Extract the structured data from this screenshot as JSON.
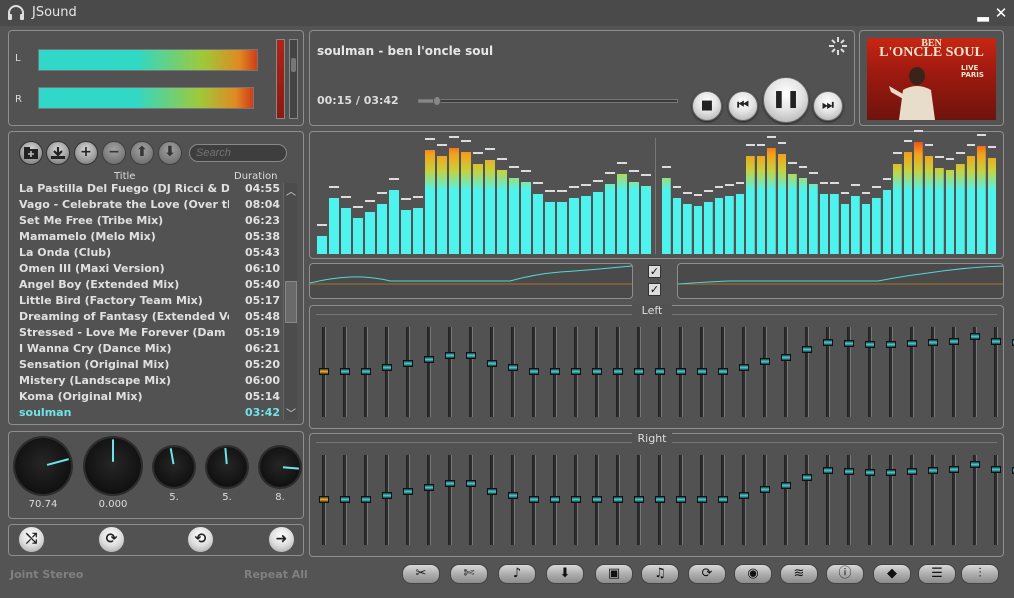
{
  "window": {
    "title": "JSound",
    "minimize_glyph": "▂",
    "close_glyph": "✕"
  },
  "vu": {
    "left_label": "L",
    "right_label": "R"
  },
  "now_playing": {
    "title": "soulman - ben l'oncle soul",
    "time": "00:15 / 03:42",
    "progress_fraction": 0.07
  },
  "controls": {
    "stop": "■",
    "prev": "⏮",
    "pause": "❚❚",
    "next": "⏭"
  },
  "album": {
    "line1": "BEN",
    "line2": "L'ONCLE SOUL",
    "line3": "LIVE",
    "line4": "PARIS"
  },
  "playlist_toolbar": {
    "search_placeholder": "Search"
  },
  "playlist": {
    "col_title": "Title",
    "col_duration": "Duration",
    "rows": [
      {
        "title": "La Pastilla Del Fuego (DJ Ricci & DF...",
        "duration": "04:55"
      },
      {
        "title": "Vago - Celebrate the Love (Over th...",
        "duration": "08:04"
      },
      {
        "title": "Set Me Free (Tribe Mix)",
        "duration": "06:23"
      },
      {
        "title": "Mamamelo (Melo Mix)",
        "duration": "05:38"
      },
      {
        "title": "La Onda (Club)",
        "duration": "05:43"
      },
      {
        "title": "Omen III (Maxi Version)",
        "duration": "06:10"
      },
      {
        "title": "Angel Boy (Extended Mix)",
        "duration": "05:40"
      },
      {
        "title": "Little Bird (Factory Team Mix)",
        "duration": "05:17"
      },
      {
        "title": "Dreaming of Fantasy (Extended Voc...",
        "duration": "05:48"
      },
      {
        "title": "Stressed - Love Me Forever (Dam D...",
        "duration": "05:19"
      },
      {
        "title": "I Wanna Cry (Dance Mix)",
        "duration": "06:21"
      },
      {
        "title": "Sensation (Original Mix)",
        "duration": "05:20"
      },
      {
        "title": "Mistery (Landscape Mix)",
        "duration": "06:00"
      },
      {
        "title": "Koma (Original Mix)",
        "duration": "05:14"
      },
      {
        "title": "soulman",
        "duration": "03:42"
      }
    ],
    "active_index": 14
  },
  "knobs": [
    {
      "value": "70.74"
    },
    {
      "value": "0.000"
    },
    {
      "value": "5."
    },
    {
      "value": "5."
    },
    {
      "value": "8."
    }
  ],
  "transport": {
    "shuffle": "⤭",
    "repeat": "⟳",
    "repeat_one": "⟲",
    "next_track": "➜"
  },
  "spectrum": {
    "left": [
      18,
      56,
      46,
      36,
      42,
      50,
      64,
      44,
      46,
      104,
      98,
      106,
      102,
      90,
      94,
      84,
      76,
      72,
      60,
      52,
      52,
      56,
      58,
      62,
      70,
      80,
      72,
      68
    ],
    "right": [
      76,
      56,
      50,
      48,
      52,
      56,
      58,
      60,
      98,
      98,
      106,
      100,
      80,
      76,
      70,
      60,
      60,
      50,
      58,
      50,
      56,
      64,
      90,
      102,
      112,
      98,
      86,
      84,
      90,
      98,
      108,
      96
    ]
  },
  "eq": {
    "left_title": "Left",
    "right_title": "Right",
    "left_levels": [
      0.5,
      0.5,
      0.5,
      0.55,
      0.6,
      0.65,
      0.7,
      0.7,
      0.6,
      0.55,
      0.5,
      0.5,
      0.5,
      0.5,
      0.5,
      0.5,
      0.5,
      0.5,
      0.5,
      0.5,
      0.55,
      0.62,
      0.67,
      0.77,
      0.85,
      0.84,
      0.83,
      0.83,
      0.84,
      0.85,
      0.86,
      0.93,
      0.87,
      0.85
    ],
    "right_levels": [
      0.5,
      0.5,
      0.5,
      0.55,
      0.6,
      0.65,
      0.7,
      0.7,
      0.6,
      0.55,
      0.5,
      0.5,
      0.5,
      0.5,
      0.5,
      0.5,
      0.5,
      0.5,
      0.5,
      0.5,
      0.55,
      0.62,
      0.67,
      0.77,
      0.85,
      0.84,
      0.83,
      0.83,
      0.84,
      0.85,
      0.86,
      0.93,
      0.87,
      0.85
    ]
  },
  "status": {
    "mode": "Joint Stereo",
    "repeat": "Repeat All"
  },
  "tools": [
    {
      "name": "tools",
      "glyph": "✂"
    },
    {
      "name": "cut",
      "glyph": "✄"
    },
    {
      "name": "microphone",
      "glyph": "♪"
    },
    {
      "name": "download",
      "glyph": "⬇"
    },
    {
      "name": "radio",
      "glyph": "▣"
    },
    {
      "name": "music",
      "glyph": "♫"
    },
    {
      "name": "convert",
      "glyph": "⟳"
    },
    {
      "name": "disc",
      "glyph": "◉"
    },
    {
      "name": "equalizer",
      "glyph": "≋"
    },
    {
      "name": "info",
      "glyph": "ⓘ"
    },
    {
      "name": "tag",
      "glyph": "◆"
    },
    {
      "name": "list",
      "glyph": "☰"
    },
    {
      "name": "mixer",
      "glyph": "⫶"
    }
  ]
}
